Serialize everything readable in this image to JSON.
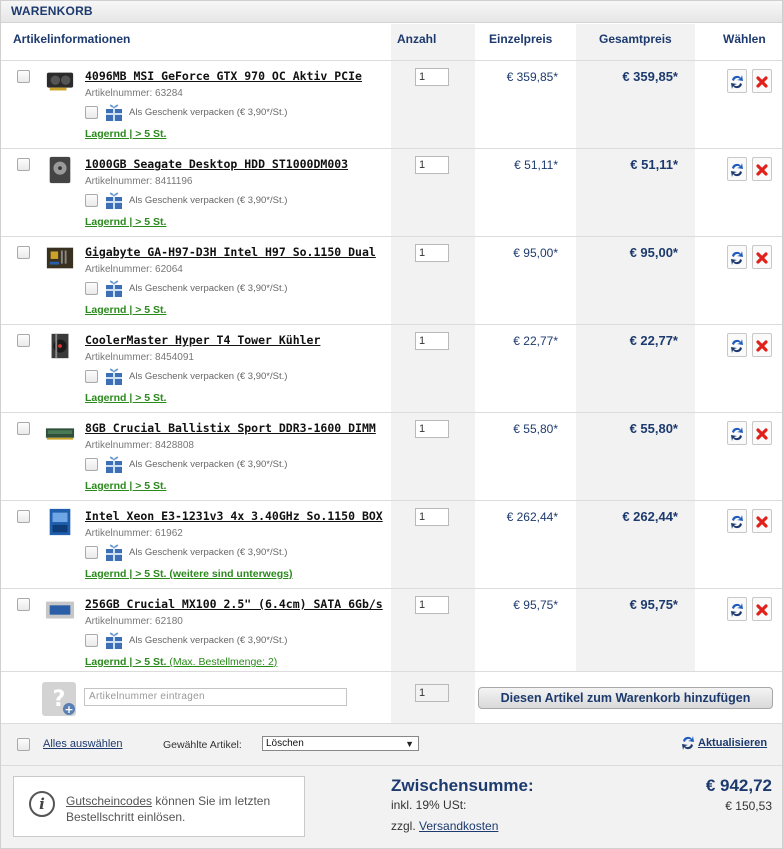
{
  "title": "WARENKORB",
  "headers": {
    "info": "Artikelinformationen",
    "qty": "Anzahl",
    "unit": "Einzelpreis",
    "total": "Gesamtpreis",
    "choose": "Wählen"
  },
  "items": [
    {
      "name": "4096MB MSI GeForce GTX 970 OC Aktiv PCIe",
      "artnr": "Artikelnummer: 63284",
      "gift": "Als Geschenk verpacken (€ 3,90*/St.)",
      "stock": "Lagernd | > 5 St.",
      "stock_extra": "",
      "qty": "1",
      "unit": "€ 359,85*",
      "total": "€ 359,85*",
      "thumb": "gpu-thumbnail"
    },
    {
      "name": "1000GB Seagate Desktop HDD ST1000DM003",
      "artnr": "Artikelnummer: 8411196",
      "gift": "Als Geschenk verpacken (€ 3,90*/St.)",
      "stock": "Lagernd | > 5 St.",
      "stock_extra": "",
      "qty": "1",
      "unit": "€ 51,11*",
      "total": "€ 51,11*",
      "thumb": "hdd-thumbnail"
    },
    {
      "name": "Gigabyte GA-H97-D3H Intel H97 So.1150 Dual",
      "artnr": "Artikelnummer: 62064",
      "gift": "Als Geschenk verpacken (€ 3,90*/St.)",
      "stock": "Lagernd | > 5 St.",
      "stock_extra": "",
      "qty": "1",
      "unit": "€ 95,00*",
      "total": "€ 95,00*",
      "thumb": "mainboard-thumbnail"
    },
    {
      "name": "CoolerMaster Hyper T4 Tower Kühler",
      "artnr": "Artikelnummer: 8454091",
      "gift": "Als Geschenk verpacken (€ 3,90*/St.)",
      "stock": "Lagernd | > 5 St.",
      "stock_extra": "",
      "qty": "1",
      "unit": "€ 22,77*",
      "total": "€ 22,77*",
      "thumb": "cooler-thumbnail"
    },
    {
      "name": "8GB Crucial Ballistix Sport DDR3-1600 DIMM",
      "artnr": "Artikelnummer: 8428808",
      "gift": "Als Geschenk verpacken (€ 3,90*/St.)",
      "stock": "Lagernd | > 5 St.",
      "stock_extra": "",
      "qty": "1",
      "unit": "€ 55,80*",
      "total": "€ 55,80*",
      "thumb": "ram-thumbnail"
    },
    {
      "name": "Intel Xeon E3-1231v3 4x 3.40GHz So.1150 BOX",
      "artnr": "Artikelnummer: 61962",
      "gift": "Als Geschenk verpacken (€ 3,90*/St.)",
      "stock": "Lagernd | > 5 St. (weitere sind unterwegs)",
      "stock_extra": "",
      "qty": "1",
      "unit": "€ 262,44*",
      "total": "€ 262,44*",
      "thumb": "cpu-thumbnail"
    },
    {
      "name": "256GB Crucial MX100 2.5\" (6.4cm) SATA 6Gb/s",
      "artnr": "Artikelnummer: 62180",
      "gift": "Als Geschenk verpacken (€ 3,90*/St.)",
      "stock": "Lagernd | > 5 St.",
      "stock_extra": "(Max. Bestellmenge: 2)",
      "qty": "1",
      "unit": "€ 95,75*",
      "total": "€ 95,75*",
      "thumb": "ssd-thumbnail"
    }
  ],
  "add_row": {
    "placeholder": "Artikelnummer eintragen",
    "qty": "1",
    "button": "Diesen Artikel zum Warenkorb hinzufügen"
  },
  "bulk": {
    "select_all": "Alles auswählen",
    "selected_label": "Gewählte Artikel:",
    "action": "Löschen",
    "update": "Aktualisieren"
  },
  "voucher": {
    "link": "Gutscheincodes",
    "text": " können Sie im letzten Bestellschritt einlösen."
  },
  "summary": {
    "subtotal_label": "Zwischensumme:",
    "subtotal_value": "€ 942,72",
    "tax_label": "inkl. 19% USt:",
    "tax_value": "€ 150,53",
    "shipping_prefix": "zzgl. ",
    "shipping_link": "Versandkosten"
  },
  "colors": {
    "accent": "#1d3a6e",
    "stock": "#2b8a1c",
    "delete": "#e0201a"
  }
}
